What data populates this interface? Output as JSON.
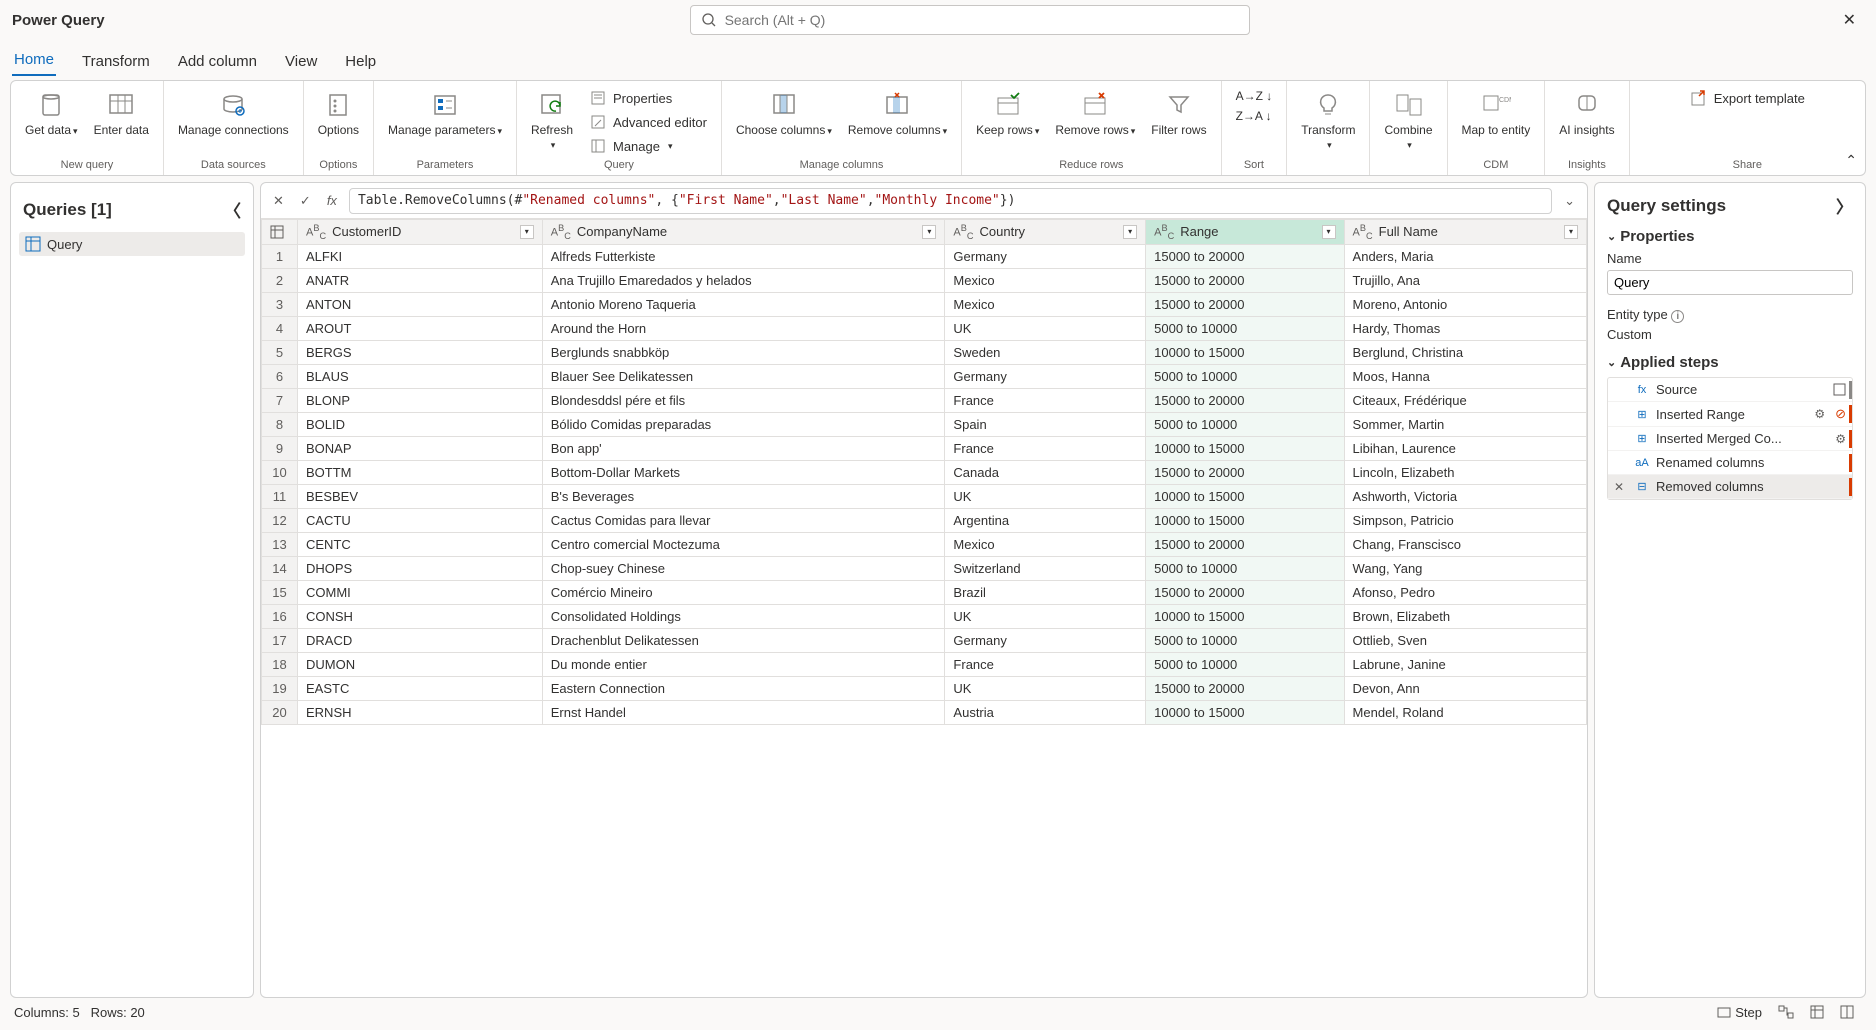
{
  "app": {
    "title": "Power Query"
  },
  "search": {
    "placeholder": "Search (Alt + Q)"
  },
  "tabs": {
    "home": "Home",
    "transform": "Transform",
    "add_column": "Add column",
    "view": "View",
    "help": "Help"
  },
  "ribbon": {
    "get_data": "Get data",
    "enter_data": "Enter data",
    "new_query": "New query",
    "manage_conn": "Manage connections",
    "data_sources": "Data sources",
    "options": "Options",
    "options_grp": "Options",
    "manage_params": "Manage parameters",
    "parameters": "Parameters",
    "refresh": "Refresh",
    "properties": "Properties",
    "advanced_editor": "Advanced editor",
    "manage": "Manage",
    "query_grp": "Query",
    "choose_cols": "Choose columns",
    "remove_cols": "Remove columns",
    "manage_cols": "Manage columns",
    "keep_rows": "Keep rows",
    "remove_rows": "Remove rows",
    "filter_rows": "Filter rows",
    "reduce_rows": "Reduce rows",
    "sort": "Sort",
    "transform_btn": "Transform",
    "combine": "Combine",
    "map_entity": "Map to entity",
    "cdm": "CDM",
    "ai_insights": "AI insights",
    "insights": "Insights",
    "export_template": "Export template",
    "share": "Share"
  },
  "queries": {
    "header": "Queries [1]",
    "item": "Query"
  },
  "formula": {
    "prefix": "Table.RemoveColumns(#",
    "arg0": "\"Renamed columns\"",
    "sep1": ", {",
    "str1": "\"First Name\"",
    "sep2": ", ",
    "str2": "\"Last Name\"",
    "sep3": ", ",
    "str3": "\"Monthly Income\"",
    "suffix": "})"
  },
  "columns": [
    "CustomerID",
    "CompanyName",
    "Country",
    "Range",
    "Full Name"
  ],
  "selected_column_index": 3,
  "rows": [
    [
      "ALFKI",
      "Alfreds Futterkiste",
      "Germany",
      "15000 to 20000",
      "Anders, Maria"
    ],
    [
      "ANATR",
      "Ana Trujillo Emaredados y helados",
      "Mexico",
      "15000 to 20000",
      "Trujillo, Ana"
    ],
    [
      "ANTON",
      "Antonio Moreno Taqueria",
      "Mexico",
      "15000 to 20000",
      "Moreno, Antonio"
    ],
    [
      "AROUT",
      "Around the Horn",
      "UK",
      "5000 to 10000",
      "Hardy, Thomas"
    ],
    [
      "BERGS",
      "Berglunds snabbköp",
      "Sweden",
      "10000 to 15000",
      "Berglund, Christina"
    ],
    [
      "BLAUS",
      "Blauer See Delikatessen",
      "Germany",
      "5000 to 10000",
      "Moos, Hanna"
    ],
    [
      "BLONP",
      "Blondesddsl pére et fils",
      "France",
      "15000 to 20000",
      "Citeaux, Frédérique"
    ],
    [
      "BOLID",
      "Bólido Comidas preparadas",
      "Spain",
      "5000 to 10000",
      "Sommer, Martin"
    ],
    [
      "BONAP",
      "Bon app'",
      "France",
      "10000 to 15000",
      "Libihan, Laurence"
    ],
    [
      "BOTTM",
      "Bottom-Dollar Markets",
      "Canada",
      "15000 to 20000",
      "Lincoln, Elizabeth"
    ],
    [
      "BESBEV",
      "B's Beverages",
      "UK",
      "10000 to 15000",
      "Ashworth, Victoria"
    ],
    [
      "CACTU",
      "Cactus Comidas para llevar",
      "Argentina",
      "10000 to 15000",
      "Simpson, Patricio"
    ],
    [
      "CENTC",
      "Centro comercial Moctezuma",
      "Mexico",
      "15000 to 20000",
      "Chang, Franscisco"
    ],
    [
      "DHOPS",
      "Chop-suey Chinese",
      "Switzerland",
      "5000 to 10000",
      "Wang, Yang"
    ],
    [
      "COMMI",
      "Comércio Mineiro",
      "Brazil",
      "15000 to 20000",
      "Afonso, Pedro"
    ],
    [
      "CONSH",
      "Consolidated Holdings",
      "UK",
      "10000 to 15000",
      "Brown, Elizabeth"
    ],
    [
      "DRACD",
      "Drachenblut Delikatessen",
      "Germany",
      "5000 to 10000",
      "Ottlieb, Sven"
    ],
    [
      "DUMON",
      "Du monde entier",
      "France",
      "5000 to 10000",
      "Labrune, Janine"
    ],
    [
      "EASTC",
      "Eastern Connection",
      "UK",
      "15000 to 20000",
      "Devon, Ann"
    ],
    [
      "ERNSH",
      "Ernst Handel",
      "Austria",
      "10000 to 15000",
      "Mendel, Roland"
    ]
  ],
  "settings": {
    "title": "Query settings",
    "properties": "Properties",
    "name_label": "Name",
    "name_value": "Query",
    "entity_type_label": "Entity type",
    "entity_type_value": "Custom",
    "applied_steps": "Applied steps",
    "steps": [
      "Source",
      "Inserted Range",
      "Inserted Merged Co...",
      "Renamed columns",
      "Removed columns"
    ]
  },
  "status": {
    "cols": "Columns: 5",
    "rows": "Rows: 20",
    "step": "Step"
  }
}
